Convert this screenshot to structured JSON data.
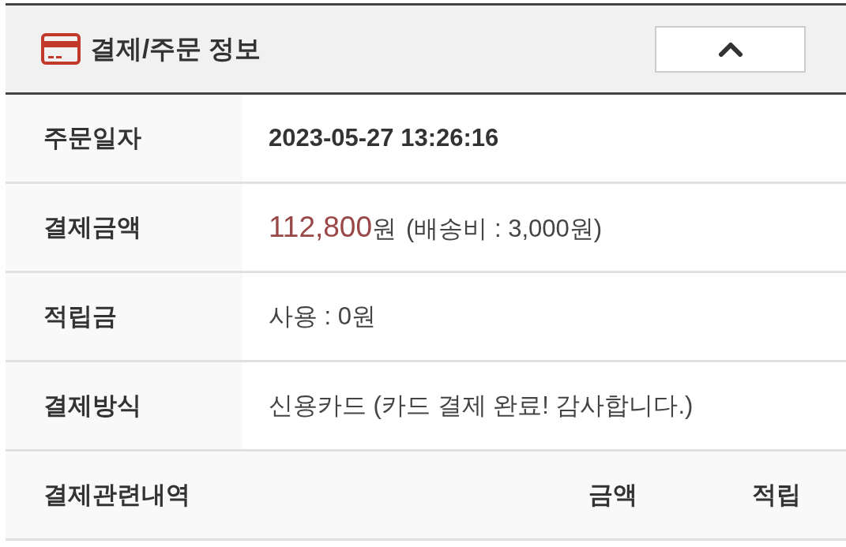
{
  "section": {
    "title": "결제/주문 정보",
    "expanded": true
  },
  "rows": [
    {
      "kind": "date",
      "label": "주문일자",
      "value": "2023-05-27 13:26:16"
    },
    {
      "kind": "amount",
      "label": "결제금액",
      "amount": "112,800",
      "unit": "원",
      "note": "(배송비 : 3,000원)"
    },
    {
      "kind": "text",
      "label": "적립금",
      "value": "사용 : 0원"
    },
    {
      "kind": "text",
      "label": "결제방식",
      "value": "신용카드 (카드 결제 완료! 감사합니다.)"
    }
  ],
  "history_header": {
    "columns": [
      "결제관련내역",
      "금액",
      "적립"
    ]
  }
}
